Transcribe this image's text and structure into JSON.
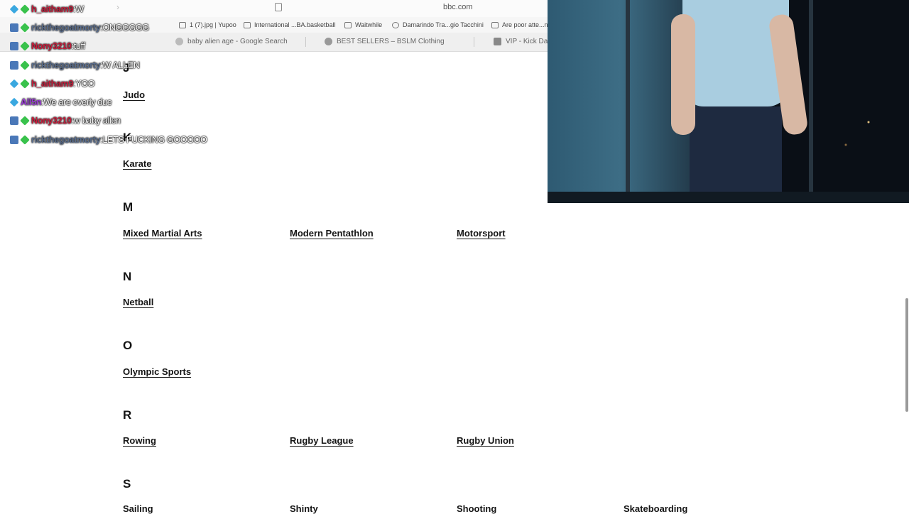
{
  "browser": {
    "address": "bbc.com",
    "bookmarks": [
      {
        "label": "1 (7).jpg | Yupoo",
        "icon": "document-icon"
      },
      {
        "label": "International ...BA.basketball",
        "icon": "basketball-icon"
      },
      {
        "label": "Waitwhile",
        "icon": "w-icon"
      },
      {
        "label": "Damarindo Tra...gio Tacchini",
        "icon": "globe-icon"
      },
      {
        "label": "Are poor atte...n",
        "icon": "sc-icon"
      }
    ],
    "tabs": [
      {
        "label": "baby alien age - Google Search",
        "icon": "google-icon"
      },
      {
        "label": "BEST SELLERS – BSLM Clothing",
        "icon": "star-icon"
      },
      {
        "label": "VIP - Kick Da",
        "icon": "kick-icon"
      }
    ]
  },
  "sections": [
    {
      "letter": "J",
      "sports": [
        "Judo"
      ]
    },
    {
      "letter": "K",
      "sports": [
        "Karate"
      ]
    },
    {
      "letter": "M",
      "sports": [
        "Mixed Martial Arts",
        "Modern Pentathlon",
        "Motorsport"
      ]
    },
    {
      "letter": "N",
      "sports": [
        "Netball"
      ]
    },
    {
      "letter": "O",
      "sports": [
        "Olympic Sports"
      ]
    },
    {
      "letter": "R",
      "sports": [
        "Rowing",
        "Rugby League",
        "Rugby Union"
      ]
    },
    {
      "letter": "S",
      "sports": [
        "Sailing",
        "Shinty",
        "Shooting",
        "Skateboarding"
      ]
    }
  ],
  "chat": [
    {
      "user": "h_aitham9",
      "sep": " : ",
      "text": "W",
      "color": "#c81e3c",
      "badges": [
        "cube",
        "gem"
      ]
    },
    {
      "user": "rickthegoatmorty",
      "sep": " : ",
      "text": "ONGGGGG",
      "color": "#5b6f8f",
      "badges": [
        "mod",
        "gem"
      ]
    },
    {
      "user": "Nony3210",
      "sep": " : ",
      "text": "tuff",
      "color": "#c81e3c",
      "badges": [
        "mod",
        "gem"
      ]
    },
    {
      "user": "rickthegoatmorty",
      "sep": " : ",
      "text": "W ALLEN",
      "color": "#5b6f8f",
      "badges": [
        "mod",
        "gem"
      ]
    },
    {
      "user": "h_aitham9",
      "sep": " : ",
      "text": "YOO",
      "color": "#c81e3c",
      "badges": [
        "cube",
        "gem"
      ]
    },
    {
      "user": "All5n",
      "sep": " : ",
      "text": "We are overly due",
      "color": "#9b3bd6",
      "badges": [
        "cube"
      ]
    },
    {
      "user": "Nony3210",
      "sep": " : ",
      "text": "w baby allen",
      "color": "#c81e3c",
      "badges": [
        "mod",
        "gem"
      ]
    },
    {
      "user": "rickthegoatmorty",
      "sep": " : ",
      "text": "LETS FUCKING GOOOOO",
      "color": "#5b6f8f",
      "badges": [
        "mod",
        "gem"
      ]
    }
  ]
}
